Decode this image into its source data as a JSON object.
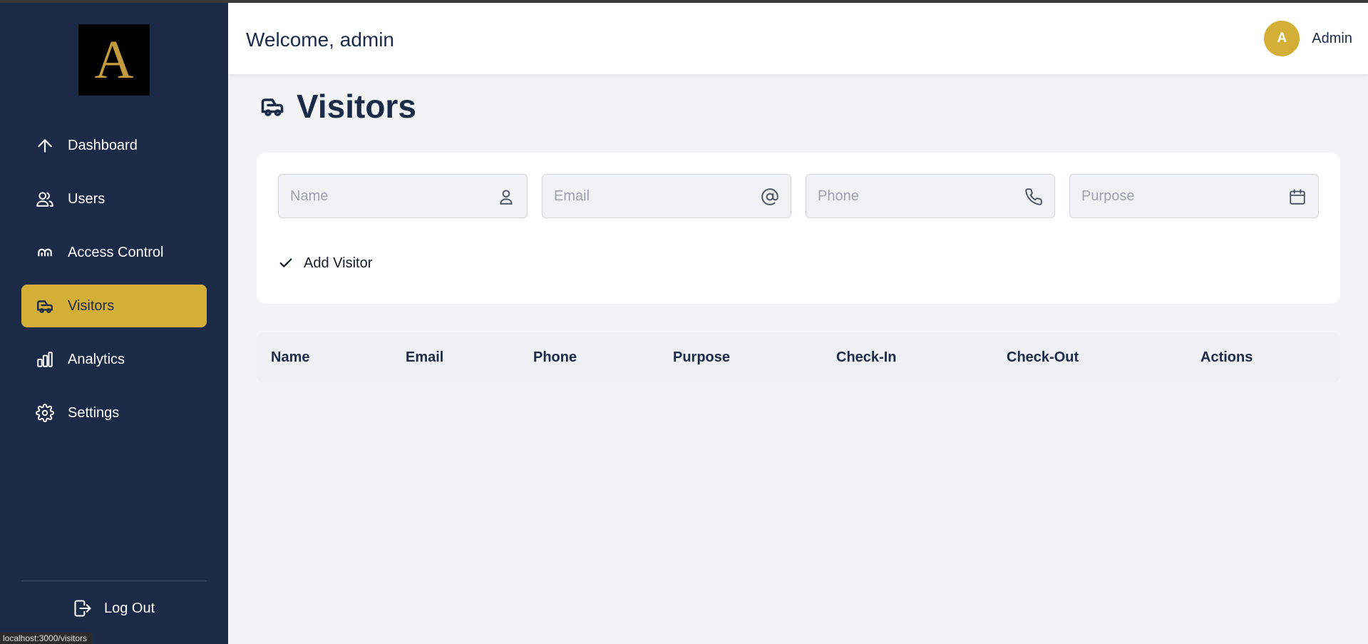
{
  "sidebar": {
    "logo_letter": "A",
    "nav": [
      {
        "label": "Dashboard",
        "icon": "arrow-up-icon"
      },
      {
        "label": "Users",
        "icon": "users-icon"
      },
      {
        "label": "Access Control",
        "icon": "access-icon"
      },
      {
        "label": "Visitors",
        "icon": "car-icon",
        "active": true
      },
      {
        "label": "Analytics",
        "icon": "bar-chart-icon"
      },
      {
        "label": "Settings",
        "icon": "gear-icon"
      }
    ],
    "logout_label": "Log Out"
  },
  "header": {
    "welcome": "Welcome, admin",
    "avatar_initial": "A",
    "user_name": "Admin"
  },
  "page": {
    "title": "Visitors"
  },
  "form": {
    "fields": [
      {
        "placeholder": "Name",
        "value": "",
        "icon": "user-icon"
      },
      {
        "placeholder": "Email",
        "value": "",
        "icon": "at-icon"
      },
      {
        "placeholder": "Phone",
        "value": "",
        "icon": "phone-icon"
      },
      {
        "placeholder": "Purpose",
        "value": "",
        "icon": "calendar-icon"
      }
    ],
    "add_label": "Add Visitor"
  },
  "table": {
    "columns": [
      "Name",
      "Email",
      "Phone",
      "Purpose",
      "Check-In",
      "Check-Out",
      "Actions"
    ],
    "rows": []
  },
  "status_bar": {
    "url": "localhost:3000/visitors"
  },
  "colors": {
    "sidebar_bg": "#1b2a47",
    "accent_gold": "#d4af37",
    "page_bg": "#f3f4f6"
  }
}
